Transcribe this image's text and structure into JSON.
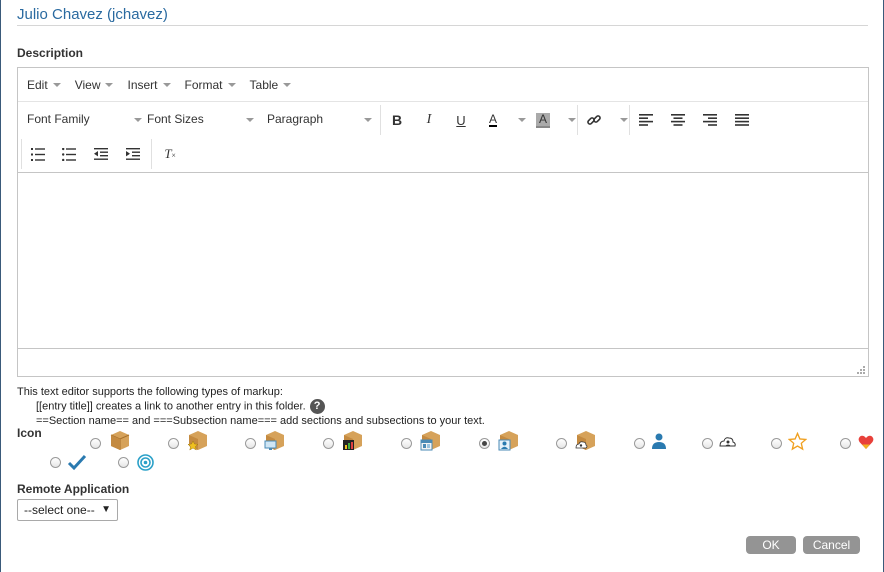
{
  "header": {
    "title": "Julio Chavez (jchavez)"
  },
  "description": {
    "label": "Description"
  },
  "editor": {
    "menu": [
      "Edit",
      "View",
      "Insert",
      "Format",
      "Table"
    ],
    "font_family": "Font Family",
    "font_sizes": "Font Sizes",
    "paragraph": "Paragraph",
    "tools": {
      "bold": "B",
      "italic": "I",
      "underline": "U",
      "text_color": "A",
      "bg_color": "A",
      "clear_format": "T"
    }
  },
  "help": {
    "line1": "This text editor supports the following types of markup:",
    "line2": "[[entry title]] creates a link to another entry in this folder.",
    "line3": "==Section name== and ===Subsection name=== add sections and subsections to your text.",
    "help_icon": "?"
  },
  "icon_section": {
    "label": "Icon",
    "options": [
      {
        "icon": "box-icon",
        "checked": false
      },
      {
        "icon": "box-star-icon",
        "checked": false
      },
      {
        "icon": "box-monitor-icon",
        "checked": false
      },
      {
        "icon": "box-chart-icon",
        "checked": false
      },
      {
        "icon": "box-calendar-icon",
        "checked": false
      },
      {
        "icon": "box-person-icon",
        "checked": true
      },
      {
        "icon": "box-cloud-icon",
        "checked": false
      },
      {
        "icon": "person-icon",
        "checked": false
      },
      {
        "icon": "cloud-person-icon",
        "checked": false
      },
      {
        "icon": "star-outline-icon",
        "checked": false
      },
      {
        "icon": "heart-icon",
        "checked": false
      },
      {
        "icon": "checkmark-icon",
        "checked": false
      },
      {
        "icon": "target-icon",
        "checked": false
      }
    ]
  },
  "remote_application": {
    "label": "Remote Application",
    "selected": "--select one--",
    "arrow": "▼"
  },
  "buttons": {
    "ok": "OK",
    "cancel": "Cancel"
  },
  "colors": {
    "title": "#2a6aa0",
    "button_bg": "#949494",
    "box_tan": "#d6a25a",
    "icon_blue": "#2a7ab0"
  }
}
